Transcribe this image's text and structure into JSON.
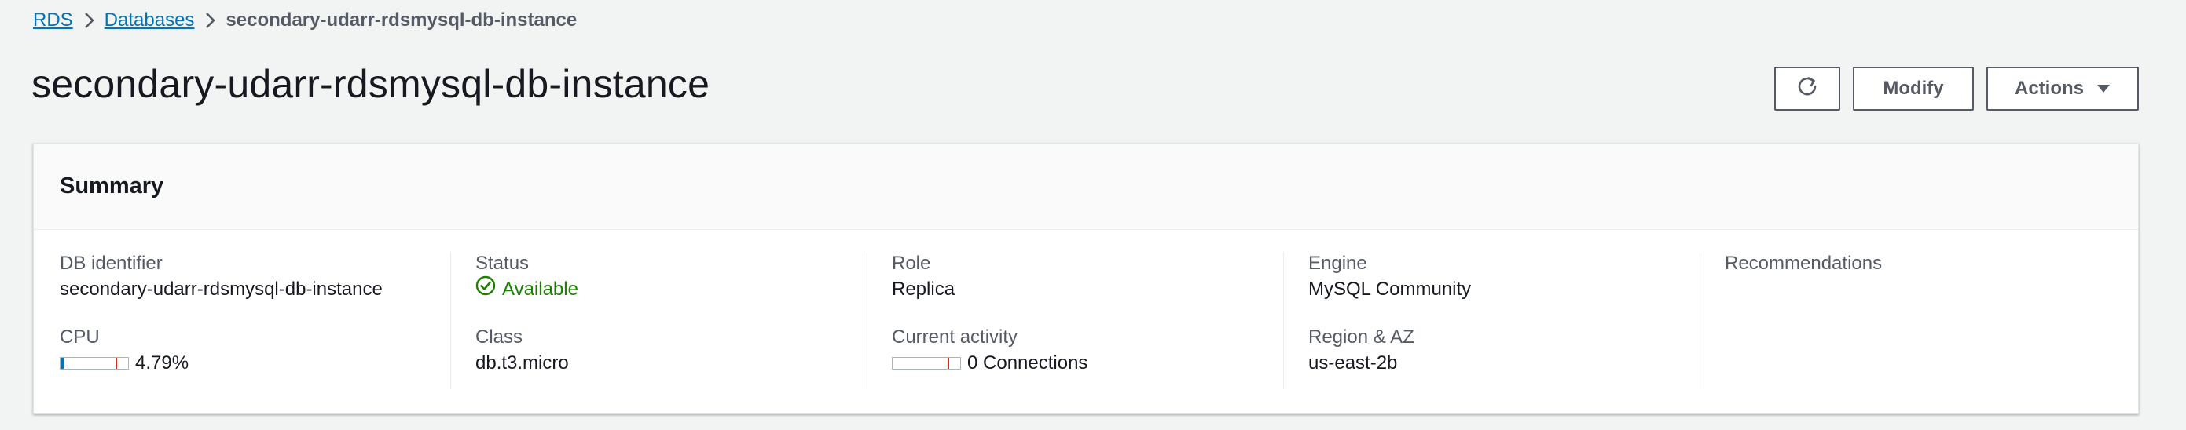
{
  "breadcrumb": {
    "items": [
      {
        "label": "RDS"
      },
      {
        "label": "Databases"
      },
      {
        "label": "secondary-udarr-rdsmysql-db-instance"
      }
    ]
  },
  "page_title": "secondary-udarr-rdsmysql-db-instance",
  "header_actions": {
    "refresh_icon": "refresh-icon",
    "modify_label": "Modify",
    "actions_label": "Actions",
    "actions_icon": "caret-down-icon"
  },
  "summary": {
    "title": "Summary",
    "db_identifier": {
      "label": "DB identifier",
      "value": "secondary-udarr-rdsmysql-db-instance"
    },
    "cpu": {
      "label": "CPU",
      "value": "4.79%",
      "fraction": 0.0479
    },
    "status": {
      "label": "Status",
      "value": "Available",
      "icon": "check-circle-icon",
      "color": "#1d8102"
    },
    "class": {
      "label": "Class",
      "value": "db.t3.micro"
    },
    "role": {
      "label": "Role",
      "value": "Replica"
    },
    "current_activity": {
      "label": "Current activity",
      "value": "0 Connections",
      "fraction": 0
    },
    "engine": {
      "label": "Engine",
      "value": "MySQL Community"
    },
    "region_az": {
      "label": "Region & AZ",
      "value": "us-east-2b"
    },
    "recommendations": {
      "label": "Recommendations"
    }
  },
  "colors": {
    "link": "#0073bb",
    "accent_fill": "#0073bb",
    "threshold_mark": "#d13212",
    "success": "#1d8102",
    "background": "#f2f3f3"
  }
}
